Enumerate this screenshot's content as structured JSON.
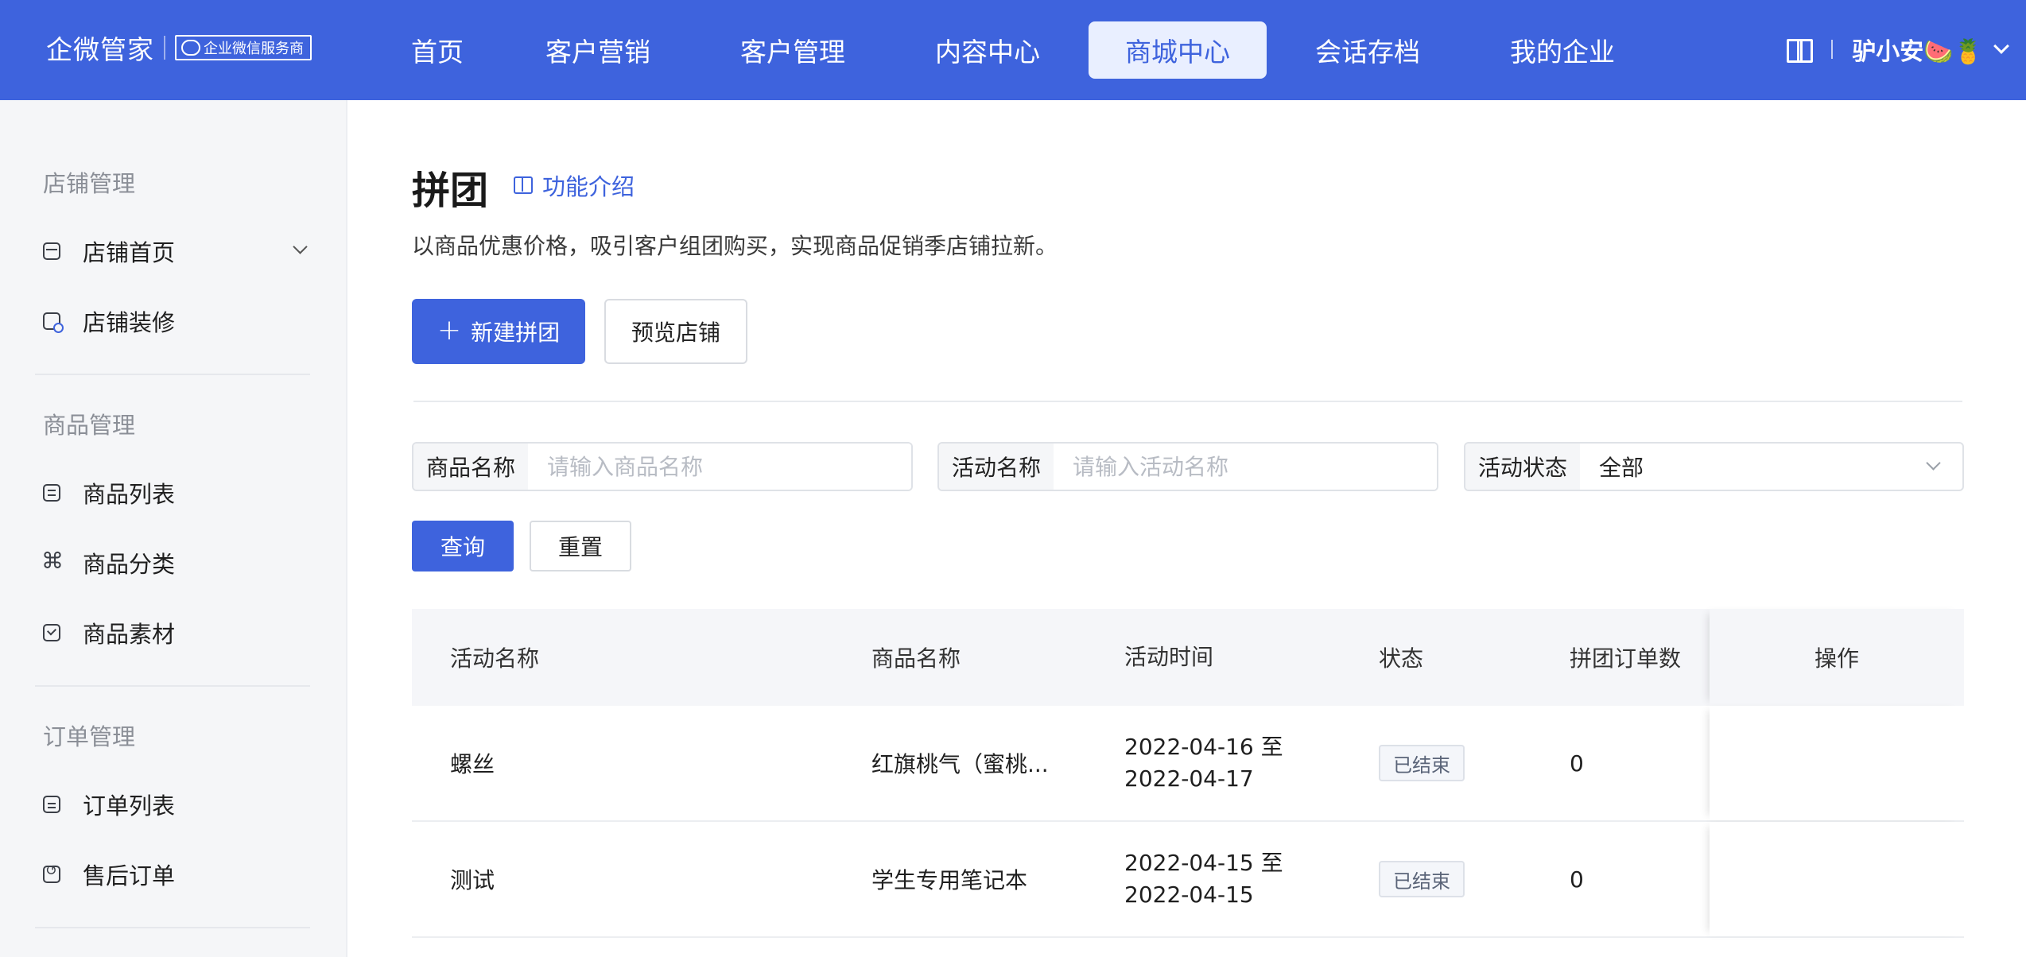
{
  "brand": {
    "name": "企微管家",
    "badge": "企业微信服务商"
  },
  "nav": {
    "items": [
      {
        "label": "首页"
      },
      {
        "label": "客户营销"
      },
      {
        "label": "客户管理"
      },
      {
        "label": "内容中心"
      },
      {
        "label": "商城中心"
      },
      {
        "label": "会话存档"
      },
      {
        "label": "我的企业"
      }
    ],
    "active_index": 4
  },
  "user": {
    "name": "驴小安🍉🍍"
  },
  "sidebar": {
    "groups": [
      {
        "title": "店铺管理",
        "items": [
          {
            "label": "店铺首页",
            "icon": "store-icon"
          },
          {
            "label": "店铺装修",
            "icon": "decorate-icon"
          }
        ]
      },
      {
        "title": "商品管理",
        "items": [
          {
            "label": "商品列表",
            "icon": "list-icon"
          },
          {
            "label": "商品分类",
            "icon": "category-icon"
          },
          {
            "label": "商品素材",
            "icon": "material-icon"
          }
        ]
      },
      {
        "title": "订单管理",
        "items": [
          {
            "label": "订单列表",
            "icon": "clipboard-icon"
          },
          {
            "label": "售后订单",
            "icon": "after-sale-icon"
          }
        ]
      }
    ]
  },
  "page": {
    "title": "拼团",
    "intro_link": "功能介绍",
    "description": "以商品优惠价格，吸引客户组团购买，实现商品促销季店铺拉新。",
    "new_button": "新建拼团",
    "preview_button": "预览店铺"
  },
  "filters": {
    "product": {
      "label": "商品名称",
      "placeholder": "请输入商品名称",
      "value": ""
    },
    "activity": {
      "label": "活动名称",
      "placeholder": "请输入活动名称",
      "value": ""
    },
    "status": {
      "label": "活动状态",
      "value": "全部"
    },
    "query_button": "查询",
    "reset_button": "重置"
  },
  "table": {
    "columns": [
      "活动名称",
      "商品名称",
      "活动时间",
      "状态",
      "拼团订单数",
      "操作"
    ],
    "rows": [
      {
        "activity": "螺丝",
        "product": "红旗桃气（蜜桃...",
        "time_start": "2022-04-16 至",
        "time_end": "2022-04-17",
        "status": "已结束",
        "orders": "0"
      },
      {
        "activity": "测试",
        "product": "学生专用笔记本",
        "time_start": "2022-04-15 至",
        "time_end": "2022-04-15",
        "status": "已结束",
        "orders": "0"
      }
    ]
  },
  "colors": {
    "primary": "#3e63dd",
    "sidebar_bg": "#f5f6f8",
    "table_header_bg": "#f5f6f9"
  }
}
